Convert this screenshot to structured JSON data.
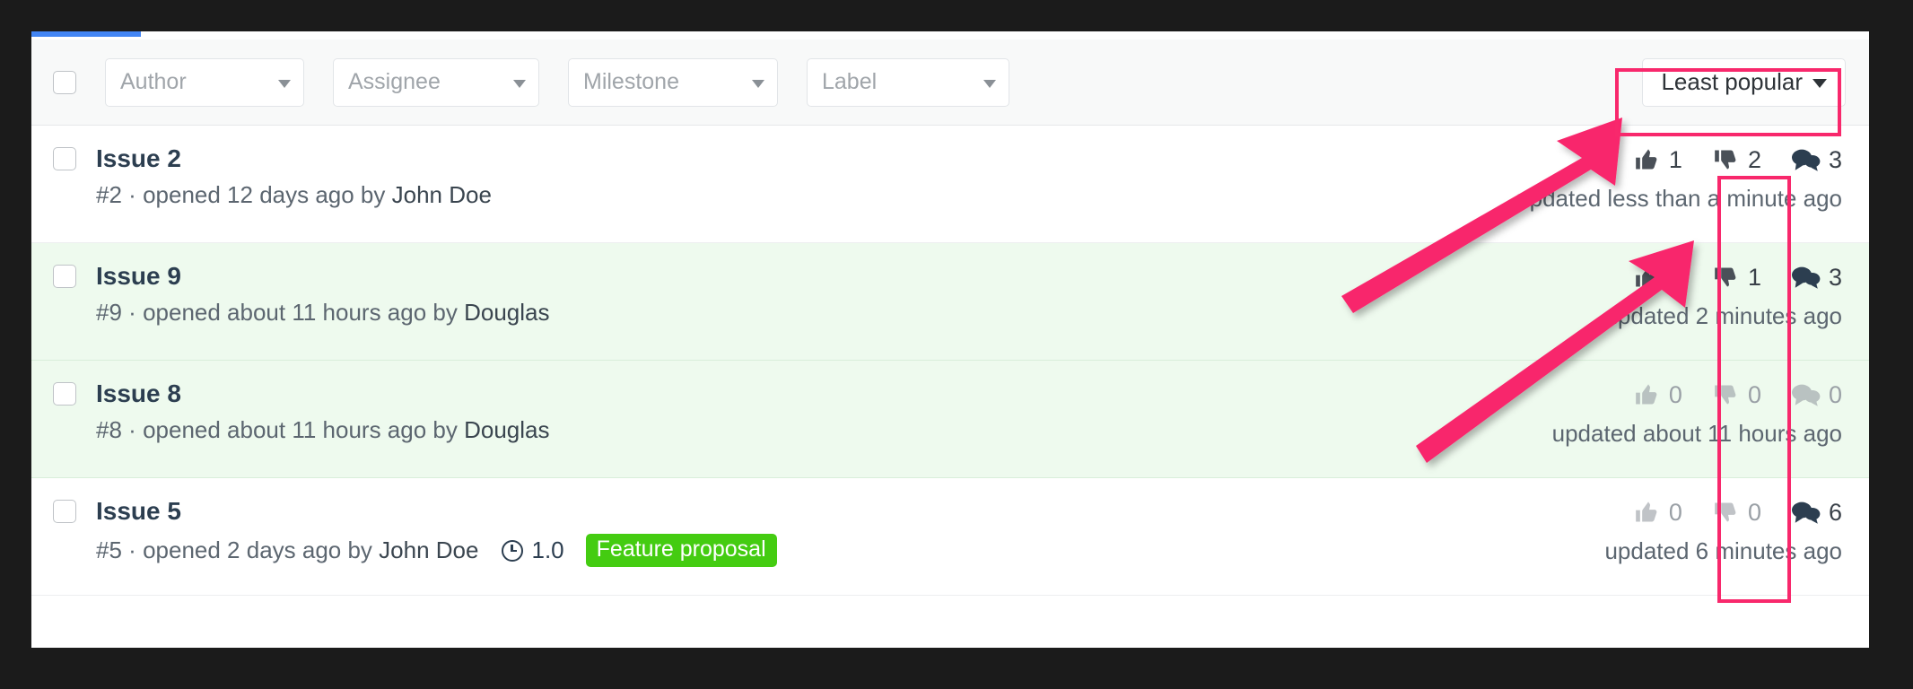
{
  "toolbar": {
    "select_all_checkbox": "select-all",
    "filters": [
      {
        "name": "author",
        "label": "Author"
      },
      {
        "name": "assignee",
        "label": "Assignee"
      },
      {
        "name": "milestone",
        "label": "Milestone"
      },
      {
        "name": "label",
        "label": "Label"
      }
    ],
    "sort": {
      "label": "Least popular"
    }
  },
  "issues": [
    {
      "title": "Issue 2",
      "number": "#2",
      "separator": "·",
      "opened": "opened 12 days ago by",
      "author": "John Doe",
      "milestone": null,
      "label": null,
      "thumbs_up": "1",
      "thumbs_up_muted": false,
      "thumbs_down": "2",
      "thumbs_down_muted": false,
      "comments": "3",
      "comments_muted": false,
      "updated": "updated less than a minute ago",
      "tinted": false
    },
    {
      "title": "Issue 9",
      "number": "#9",
      "separator": "·",
      "opened": "opened about 11 hours ago by",
      "author": "Douglas",
      "milestone": null,
      "label": null,
      "thumbs_up": "0",
      "thumbs_up_muted": false,
      "thumbs_down": "1",
      "thumbs_down_muted": false,
      "comments": "3",
      "comments_muted": false,
      "updated": "updated 2 minutes ago",
      "tinted": true
    },
    {
      "title": "Issue 8",
      "number": "#8",
      "separator": "·",
      "opened": "opened about 11 hours ago by",
      "author": "Douglas",
      "milestone": null,
      "label": null,
      "thumbs_up": "0",
      "thumbs_up_muted": true,
      "thumbs_down": "0",
      "thumbs_down_muted": true,
      "comments": "0",
      "comments_muted": true,
      "updated": "updated about 11 hours ago",
      "tinted": true
    },
    {
      "title": "Issue 5",
      "number": "#5",
      "separator": "·",
      "opened": "opened 2 days ago by",
      "author": "John Doe",
      "milestone": "1.0",
      "label": "Feature proposal",
      "thumbs_up": "0",
      "thumbs_up_muted": true,
      "thumbs_down": "0",
      "thumbs_down_muted": true,
      "comments": "6",
      "comments_muted": false,
      "updated": "updated 6 minutes ago",
      "tinted": false
    }
  ],
  "annotations": {
    "highlight_color": "#f8286c",
    "boxes": [
      {
        "name": "sort-control-highlight"
      },
      {
        "name": "thumbs-down-column-highlight"
      }
    ],
    "arrows": [
      {
        "name": "arrow-to-sort-control"
      },
      {
        "name": "arrow-to-thumbs-down-column"
      }
    ]
  },
  "colors": {
    "accent_tab": "#4285f4",
    "label_badge": "#44cc11",
    "row_tint": "#eefaee"
  }
}
